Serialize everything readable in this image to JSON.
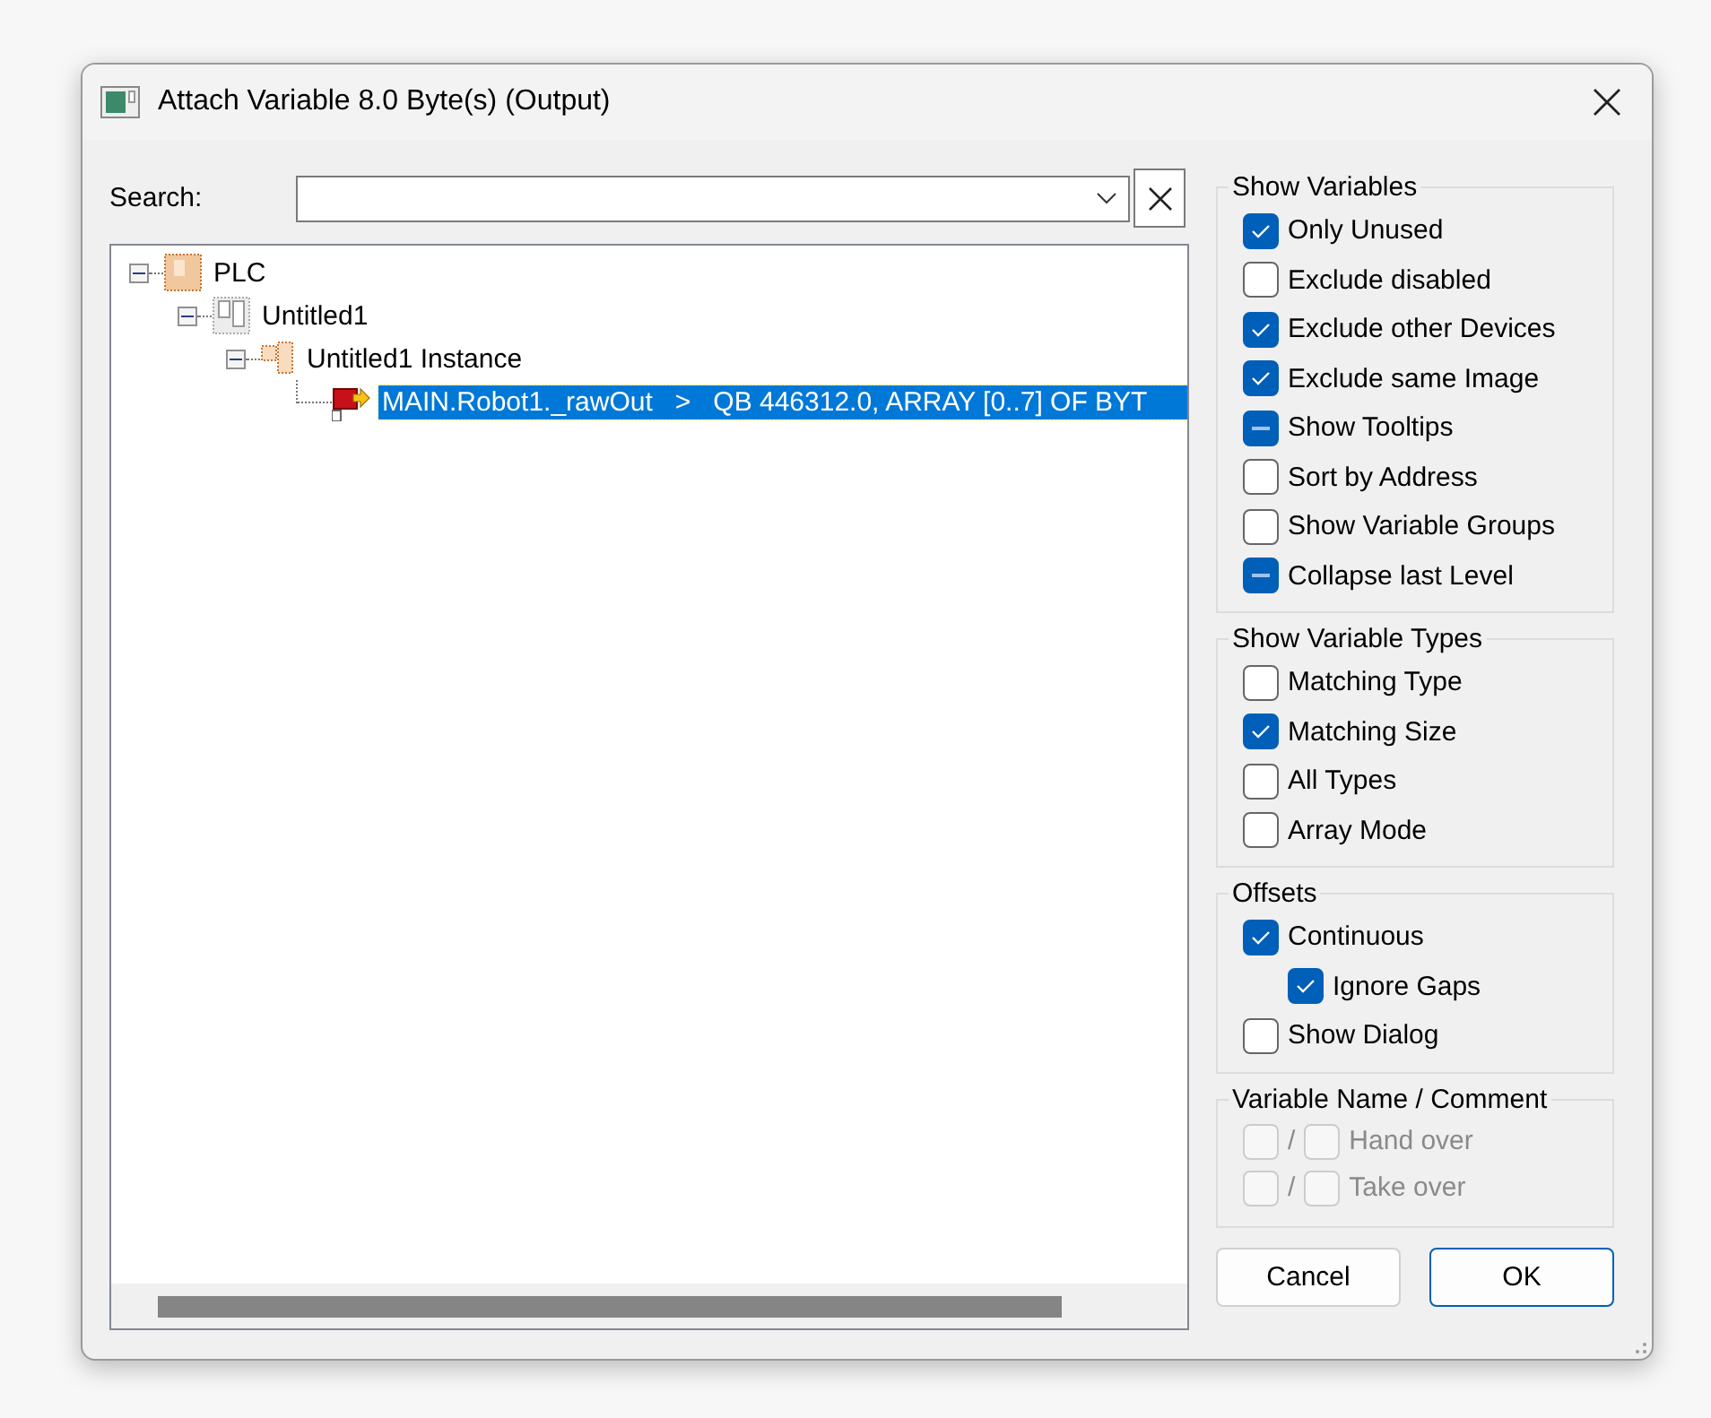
{
  "window": {
    "title": "Attach Variable 8.0 Byte(s) (Output)"
  },
  "search": {
    "label": "Search:"
  },
  "tree": [
    {
      "label": "PLC",
      "kind": "plc",
      "expanded": true,
      "selected": false,
      "children": [
        {
          "label": "Untitled1",
          "kind": "project",
          "expanded": true,
          "selected": false,
          "children": [
            {
              "label": "Untitled1 Instance",
              "kind": "instance",
              "expanded": true,
              "selected": false,
              "children": [
                {
                  "label": "MAIN.Robot1._rawOut   >   QB 446312.0, ARRAY [0..7] OF BYT",
                  "kind": "variable",
                  "selected": true
                }
              ]
            }
          ]
        }
      ]
    }
  ],
  "groups": [
    {
      "title": "Show Variables",
      "options": [
        {
          "label": "Only Unused",
          "checked": true,
          "indeterminate": false
        },
        {
          "label": "Exclude disabled",
          "checked": false,
          "indeterminate": false
        },
        {
          "label": "Exclude other Devices",
          "checked": true,
          "indeterminate": false
        },
        {
          "label": "Exclude same Image",
          "checked": true,
          "indeterminate": false
        },
        {
          "label": "Show Tooltips",
          "checked": true,
          "indeterminate": true
        },
        {
          "label": "Sort by Address",
          "checked": false,
          "indeterminate": false
        },
        {
          "label": "Show Variable Groups",
          "checked": false,
          "indeterminate": false
        },
        {
          "label": "Collapse last Level",
          "checked": true,
          "indeterminate": true
        }
      ]
    },
    {
      "title": "Show Variable Types",
      "options": [
        {
          "label": "Matching Type",
          "checked": false,
          "indeterminate": false
        },
        {
          "label": "Matching Size",
          "checked": true,
          "indeterminate": false
        },
        {
          "label": "All Types",
          "checked": false,
          "indeterminate": false
        },
        {
          "label": "Array Mode",
          "checked": false,
          "indeterminate": false
        }
      ]
    },
    {
      "title": "Offsets",
      "options": [
        {
          "label": "Continuous",
          "checked": true,
          "indeterminate": false,
          "children": [
            {
              "label": "Ignore Gaps",
              "checked": true,
              "indeterminate": false
            }
          ]
        },
        {
          "label": "Show Dialog",
          "checked": false,
          "indeterminate": false
        }
      ]
    }
  ],
  "name_comment": {
    "title": "Variable Name / Comment",
    "rows": [
      {
        "separator": "/",
        "label": "Hand over",
        "name_checked": false,
        "comment_checked": false,
        "disabled": true
      },
      {
        "separator": "/",
        "label": "Take over",
        "name_checked": false,
        "comment_checked": false,
        "disabled": true
      }
    ]
  },
  "buttons": [
    {
      "label": "Cancel",
      "default": false
    },
    {
      "label": "OK",
      "default": true
    }
  ]
}
